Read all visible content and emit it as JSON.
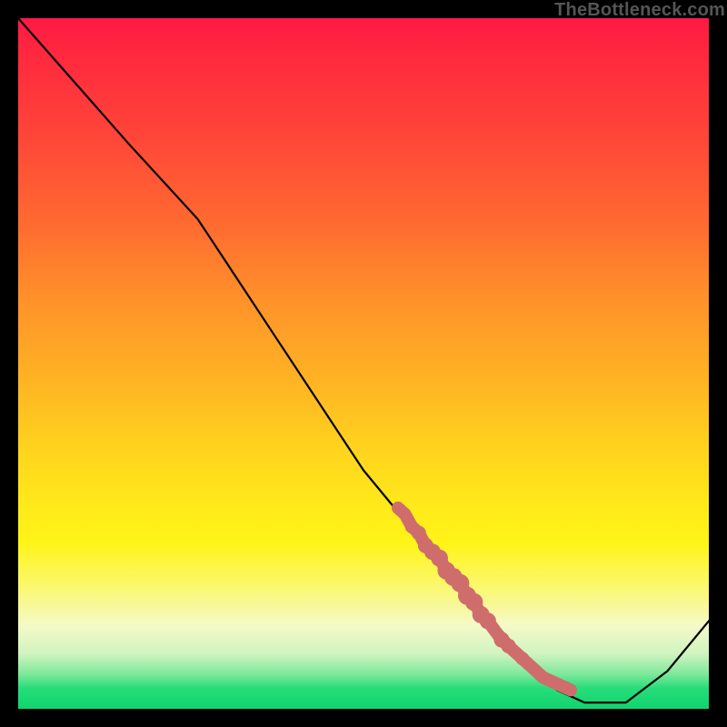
{
  "watermark": "TheBottleneck.com",
  "colors": {
    "gradient_top": "#ff1a44",
    "gradient_mid": "#ffe81a",
    "gradient_bottom": "#11d46e",
    "curve": "#000000",
    "marker": "#cf6d6d",
    "frame": "#000000"
  },
  "chart_data": {
    "type": "line",
    "title": "",
    "xlabel": "",
    "ylabel": "",
    "xlim": [
      0,
      100
    ],
    "ylim": [
      0,
      110
    ],
    "curve": {
      "x": [
        0,
        8,
        16,
        26,
        38,
        50,
        62,
        72,
        78,
        82,
        88,
        94,
        100
      ],
      "y": [
        110,
        100,
        90,
        78,
        58,
        38,
        22,
        10,
        3,
        1,
        1,
        6,
        14
      ]
    },
    "marker_cluster": {
      "comment": "dense streak of salmon dots along the descending limb, roughly x 55→80, y 32→3",
      "points": [
        {
          "x": 55,
          "y": 32
        },
        {
          "x": 56,
          "y": 31
        },
        {
          "x": 57,
          "y": 29
        },
        {
          "x": 58,
          "y": 28
        },
        {
          "x": 59,
          "y": 26
        },
        {
          "x": 60,
          "y": 25
        },
        {
          "x": 61,
          "y": 24
        },
        {
          "x": 62,
          "y": 22
        },
        {
          "x": 63,
          "y": 21
        },
        {
          "x": 64,
          "y": 20
        },
        {
          "x": 65,
          "y": 18
        },
        {
          "x": 66,
          "y": 17
        },
        {
          "x": 67,
          "y": 15
        },
        {
          "x": 68,
          "y": 14
        },
        {
          "x": 70,
          "y": 11
        },
        {
          "x": 71,
          "y": 10
        },
        {
          "x": 73,
          "y": 8
        },
        {
          "x": 75,
          "y": 6
        },
        {
          "x": 76,
          "y": 5
        },
        {
          "x": 78,
          "y": 4
        },
        {
          "x": 80,
          "y": 3
        }
      ]
    }
  }
}
